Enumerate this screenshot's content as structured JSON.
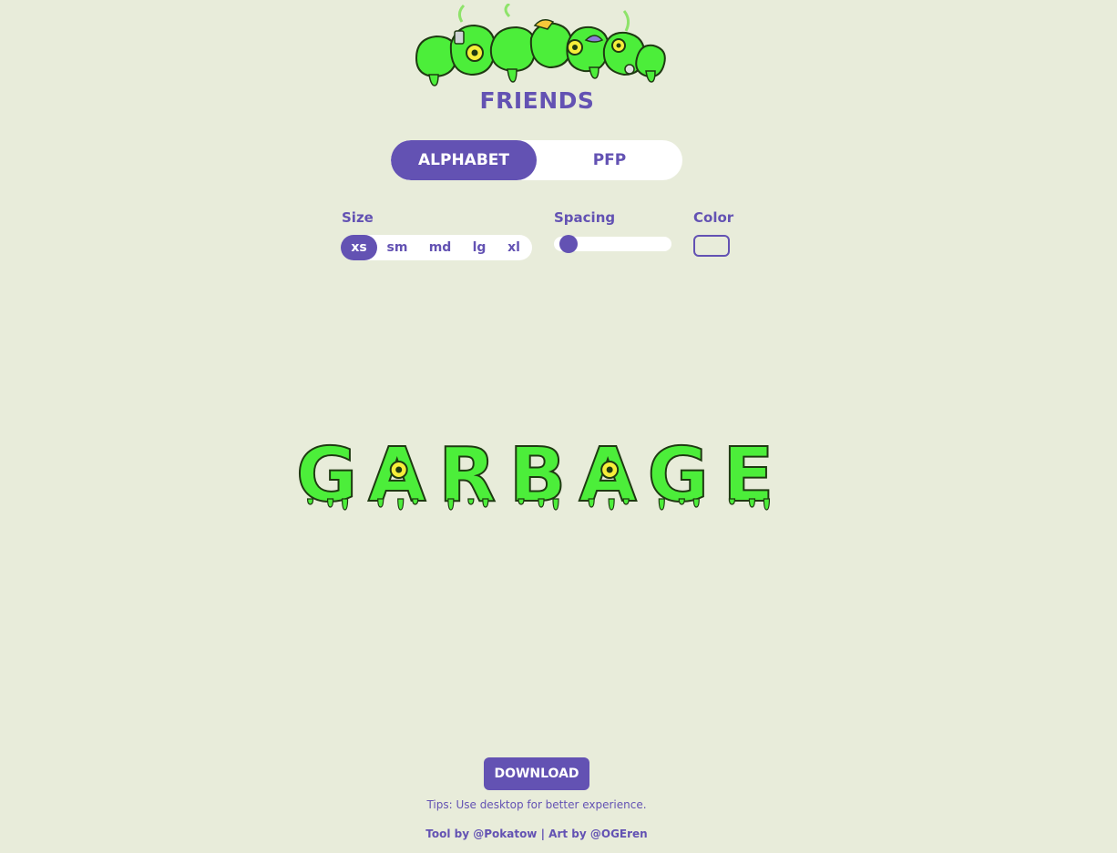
{
  "logo": {
    "wordmark": "GARBAGE",
    "subtitle": "FRIENDS"
  },
  "mode_toggle": {
    "tabs": [
      {
        "label": "ALPHABET",
        "active": true
      },
      {
        "label": "PFP",
        "active": false
      }
    ]
  },
  "controls": {
    "size": {
      "label": "Size",
      "options": [
        "xs",
        "sm",
        "md",
        "lg",
        "xl"
      ],
      "selected": "xs"
    },
    "spacing": {
      "label": "Spacing",
      "value_fraction": 0.0
    },
    "color": {
      "label": "Color"
    }
  },
  "preview": {
    "text": "GARBAGE",
    "letters": [
      "G",
      "A",
      "R",
      "B",
      "A",
      "G",
      "E"
    ]
  },
  "footer": {
    "download_label": "DOWNLOAD",
    "tips": "Tips: Use desktop for better experience.",
    "credit_tool": "Tool by @Pokatow",
    "credit_separator": "|",
    "credit_art": "Art by @OGEren"
  },
  "colors": {
    "background": "#e8ecda",
    "accent": "#6352b3",
    "slime_green": "#4cee3a",
    "slime_light": "#8bf55a",
    "slime_outline": "#1f3a12"
  },
  "icons": {
    "logo": "garbage-friends-logo",
    "letter_art": "slime-letter-icon"
  }
}
